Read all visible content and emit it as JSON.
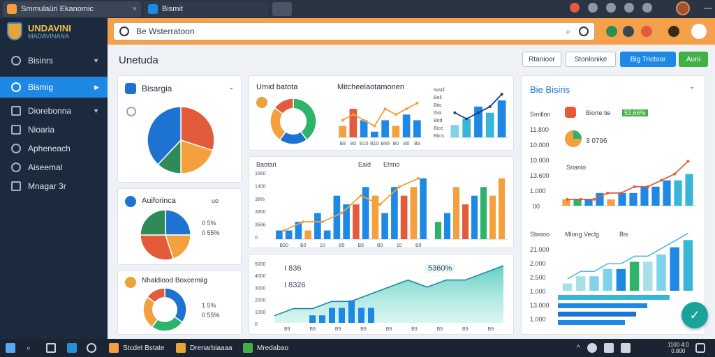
{
  "window": {
    "tabs": [
      {
        "label": "Smmulaüri Ekanomic",
        "close": "×"
      },
      {
        "label": "Bismit"
      }
    ],
    "controls": {
      "minimize": "—",
      "maximize": "▢",
      "close": "✕"
    }
  },
  "brand": {
    "title": "UNDAVINI",
    "subtitle": "MADAVINANA"
  },
  "sidebar": {
    "items": [
      {
        "label": "Bisinrs",
        "icon": "speedometer-icon",
        "chevron": true
      },
      {
        "label": "Bismig",
        "icon": "refresh-icon",
        "chevron": true,
        "active": true
      },
      {
        "label": "Diorebonna",
        "icon": "square-icon",
        "chevron": true
      },
      {
        "label": "Nioaria",
        "icon": "document-icon"
      },
      {
        "label": "Apheneach",
        "icon": "user-icon"
      },
      {
        "label": "Aiseemal",
        "icon": "gear-icon"
      },
      {
        "label": "Mnagar 3r",
        "icon": "monitor-icon"
      }
    ]
  },
  "addressbar": {
    "url": "Be Wsterratoon"
  },
  "page": {
    "title": "Unetuda"
  },
  "header_buttons": [
    {
      "label": "Rtanioor",
      "style": "outline"
    },
    {
      "label": "Stonlonike",
      "style": "outline"
    },
    {
      "label": "Big Trictoor",
      "style": "primary"
    },
    {
      "label": "Auni",
      "style": "success"
    }
  ],
  "cards": {
    "bisargia": {
      "title": "Bisargia"
    },
    "auiforinca": {
      "title": "Auiforinca",
      "legend": [
        "0 5%",
        "0 55%"
      ],
      "badge": "uo"
    },
    "nhaldiood": {
      "title": "Nhaldiood Boxcemiig",
      "legend": [
        "1 5%",
        "0 55%"
      ]
    },
    "umid": {
      "title": "Umid batota"
    },
    "mitchel": {
      "title": "Mitcheelaotamonen",
      "ylabels": [
        "Iwstil",
        "Bell",
        "Bitc",
        "Ihot",
        "Bird",
        "Bice",
        "Bitcs"
      ],
      "xlabels": [
        "B9",
        "B0",
        "B10",
        "B10",
        "B99",
        "B0",
        "B0",
        "B9"
      ]
    },
    "combo": {
      "title": "Baotari",
      "legend": [
        "Eald",
        "Ehtno"
      ],
      "ylabels": [
        "1660",
        "1400",
        "38%",
        "3300",
        "3566",
        "0"
      ],
      "xlabels": [
        "B90",
        "B0",
        "10",
        "B9",
        "B9",
        "B9",
        "10",
        "B9"
      ]
    },
    "area": {
      "ylabels": [
        "5000",
        "4000",
        "3000",
        "2000",
        "1000",
        "0"
      ],
      "legend": [
        "I 836",
        "I 8326"
      ],
      "badge": "5360%",
      "xlabels": [
        "B9",
        "B9",
        "B9",
        "B9",
        "B9",
        "B9",
        "B9",
        "B9",
        "B9"
      ]
    },
    "biebisris": {
      "title": "Bie Bisiris",
      "rows": [
        "Smillon",
        "11.800",
        "10.000",
        "10.000",
        "13.600",
        "1.000",
        "00"
      ],
      "badge1_label": "Biorte:tie",
      "badge1_value": "53,66%",
      "badge2_value": "3 0796",
      "series_label": "Srianlo",
      "legend2_label": "Sbiooo",
      "legend2_items": [
        "Mlong Veclg",
        "Bis"
      ],
      "rows2": [
        "21.000",
        "2.000",
        "2.500",
        "1.000",
        "13.000",
        "1.000"
      ]
    }
  },
  "fab": {
    "label": "✓"
  },
  "taskbar": {
    "items": [
      "Stcdet Bstate",
      "Drenarbiaaaa",
      "Mredabao"
    ],
    "clock": [
      "1100 4:0",
      "0.800"
    ]
  },
  "chart_data": [
    {
      "type": "pie",
      "name": "bisargia-donut",
      "values": [
        30,
        20,
        12,
        38
      ],
      "colors": [
        "#e45b3c",
        "#f4a03f",
        "#2e8b57",
        "#1e73d2"
      ]
    },
    {
      "type": "pie",
      "name": "auiforinca-pie",
      "values": [
        25,
        20,
        30,
        25
      ],
      "colors": [
        "#1e73d2",
        "#f4a03f",
        "#e45b3c",
        "#2e8b57"
      ]
    },
    {
      "type": "pie",
      "name": "nhaldiood-donut",
      "values": [
        35,
        25,
        25,
        15
      ],
      "colors": [
        "#1e73d2",
        "#2eb36a",
        "#f4a03f",
        "#e45b3c"
      ]
    },
    {
      "type": "pie",
      "name": "umid-donut",
      "values": [
        40,
        20,
        25,
        15
      ],
      "colors": [
        "#2eb36a",
        "#1e73d2",
        "#f4a03f",
        "#e45b3c"
      ]
    },
    {
      "type": "bar",
      "name": "mitchel-bars",
      "values": [
        2,
        5,
        3,
        1,
        3,
        2,
        4,
        3
      ],
      "colors": [
        "#f4a03f",
        "#e45b3c",
        "#1e88e5",
        "#1e88e5",
        "#1e88e5",
        "#f4a03f",
        "#1e88e5",
        "#1e88e5"
      ],
      "line": [
        3,
        4,
        3,
        2,
        5,
        4,
        5,
        6
      ]
    },
    {
      "type": "bar",
      "name": "mitchel-right",
      "values": [
        2,
        3,
        5,
        4,
        6
      ],
      "colors": [
        "#7ed3e8",
        "#38b6d8",
        "#1e88e5",
        "#38b6d8",
        "#1e88e5"
      ],
      "line": [
        4,
        3,
        4,
        5,
        7
      ]
    },
    {
      "type": "bar",
      "name": "combo-bars",
      "values": [
        1,
        1,
        2,
        1,
        3,
        1,
        5,
        4,
        4,
        6,
        5,
        3,
        6,
        5,
        6,
        7
      ],
      "colors": [
        "#1e88e5",
        "#1e88e5",
        "#1e88e5",
        "#f4a03f",
        "#1e88e5",
        "#1e88e5",
        "#1e88e5",
        "#1e88e5",
        "#e45b3c",
        "#1e88e5",
        "#f4a03f",
        "#1e88e5",
        "#1e88e5",
        "#e45b3c",
        "#f4a03f",
        "#1e88e5"
      ],
      "line": [
        1,
        2,
        2,
        3,
        5,
        4,
        6,
        7
      ]
    },
    {
      "type": "bar",
      "name": "combo-right",
      "values": [
        2,
        3,
        6,
        4,
        5,
        6,
        5,
        7
      ],
      "colors": [
        "#2eb36a",
        "#1e88e5",
        "#f4a03f",
        "#e45b3c",
        "#1e88e5",
        "#2eb36a",
        "#f4a03f",
        "#f4a03f"
      ]
    },
    {
      "type": "area",
      "name": "area-trend",
      "values": [
        1,
        2,
        2,
        3,
        3,
        4,
        5,
        6,
        5,
        6,
        6,
        7,
        8
      ],
      "bars": [
        1,
        1,
        2,
        2,
        3,
        2,
        2
      ]
    },
    {
      "type": "bar",
      "name": "biebisris-bars",
      "values": [
        1,
        1,
        1,
        2,
        1,
        2,
        2,
        3,
        3,
        4,
        4,
        5
      ],
      "colors": [
        "#f4a03f",
        "#2eb36a",
        "#1e88e5",
        "#1e88e5",
        "#f4a03f",
        "#1e88e5",
        "#1e88e5",
        "#1e88e5",
        "#1e88e5",
        "#1e88e5",
        "#38b6d8",
        "#38b6d8"
      ],
      "line": [
        1,
        1,
        1,
        2,
        2,
        3,
        3,
        4,
        5,
        7
      ]
    },
    {
      "type": "bar",
      "name": "biebisris-lower",
      "values": [
        1,
        2,
        2,
        3,
        3,
        4,
        4,
        5,
        6,
        7
      ],
      "colors": [
        "#a8e0e8",
        "#a8e0e8",
        "#7ed3e8",
        "#7ed3e8",
        "#1e88e5",
        "#2eb36a",
        "#a8e0e8",
        "#7ed3e8",
        "#1e88e5",
        "#38b6d8"
      ],
      "hbars": [
        10,
        8,
        7,
        6
      ]
    }
  ]
}
